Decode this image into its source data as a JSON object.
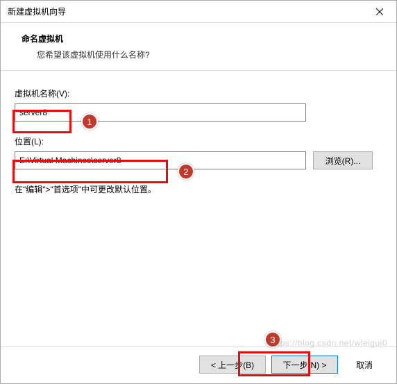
{
  "titlebar": {
    "title": "新建虚拟机向导"
  },
  "header": {
    "heading": "命名虚拟机",
    "subheading": "您希望该虚拟机使用什么名称?"
  },
  "fields": {
    "name_label": "虚拟机名称(V):",
    "name_value": "server8",
    "location_label": "位置(L):",
    "location_value": "E:\\Virtual Machines\\server8",
    "browse_label": "浏览(R)..."
  },
  "hint": "在\"编辑\">\"首选项\"中可更改默认位置。",
  "footer": {
    "back": "< 上一步(B)",
    "next": "下一步(N) >",
    "cancel": "取消"
  },
  "annotations": {
    "badge1": "1",
    "badge2": "2",
    "badge3": "3"
  },
  "watermark": "https://blog.csdn.net/wleigui0"
}
